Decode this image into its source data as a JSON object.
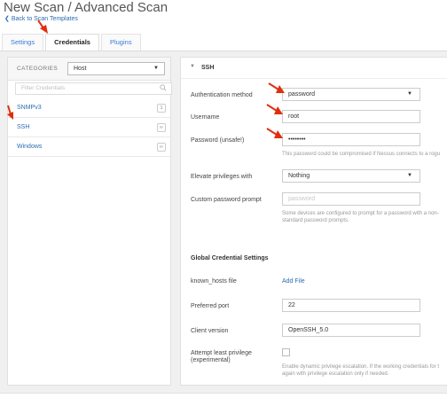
{
  "page": {
    "title": "New Scan / Advanced Scan",
    "back_link": "Back to Scan Templates"
  },
  "tabs": [
    {
      "label": "Settings",
      "active": false
    },
    {
      "label": "Credentials",
      "active": true
    },
    {
      "label": "Plugins",
      "active": false
    }
  ],
  "categories": {
    "label": "CATEGORIES",
    "selected": "Host",
    "filter_placeholder": "Filter Credentials",
    "items": [
      {
        "label": "SNMPv3",
        "count": "1"
      },
      {
        "label": "SSH",
        "count": "∞"
      },
      {
        "label": "Windows",
        "count": "∞"
      }
    ]
  },
  "ssh": {
    "section_title": "SSH",
    "auth_method": {
      "label": "Authentication method",
      "value": "password"
    },
    "username": {
      "label": "Username",
      "value": "root"
    },
    "password": {
      "label": "Password (unsafe!)",
      "value": "••••••••",
      "hint": "This password could be compromised if Nessus connects to a rogu"
    },
    "elevate": {
      "label": "Elevate privileges with",
      "value": "Nothing"
    },
    "custom_prompt": {
      "label": "Custom password prompt",
      "placeholder": "password",
      "hint_line1": "Some devices are configured to prompt for a password with a non-",
      "hint_line2": "standard password prompts."
    }
  },
  "global": {
    "title": "Global Credential Settings",
    "known_hosts": {
      "label": "known_hosts file",
      "link": "Add File"
    },
    "preferred_port": {
      "label": "Preferred port",
      "value": "22"
    },
    "client_version": {
      "label": "Client version",
      "value": "OpenSSH_5.0"
    },
    "least_privilege": {
      "label_line1": "Attempt least privilege",
      "label_line2": "(experimental)",
      "hint_line1": "Enable dynamic privilege escalation. If the working credentials for t",
      "hint_line2": "again with privilege escalation only if needed."
    }
  },
  "colors": {
    "link": "#2b6cb0",
    "annotation_arrow": "#e02f10"
  },
  "icons": [
    "chevron-left-icon",
    "caret-down-icon",
    "search-icon",
    "chevron-down-icon",
    "red-arrow-annotation"
  ]
}
